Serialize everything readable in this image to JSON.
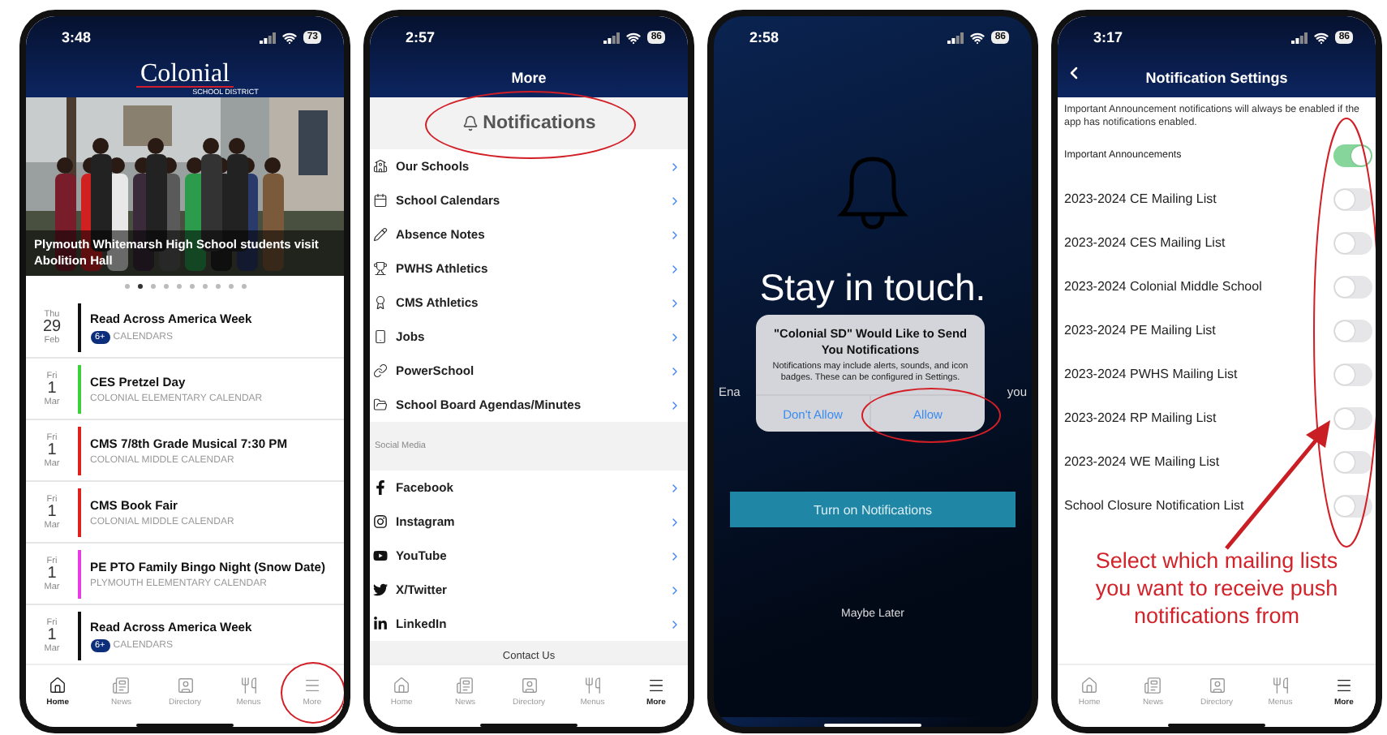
{
  "phones": [
    {
      "kind": "home",
      "status": {
        "time": "3:48",
        "battery": "73"
      },
      "logo": {
        "name": "Colonial",
        "tagline": "SCHOOL DISTRICT"
      },
      "hero": {
        "kind": "picture",
        "caption": "Plymouth Whitemarsh High School students visit Abolition Hall"
      },
      "dots": [
        {
          "selected": false
        },
        {
          "selected": true
        },
        {
          "selected": false
        },
        {
          "selected": false
        },
        {
          "selected": false
        },
        {
          "selected": false
        },
        {
          "selected": false
        },
        {
          "selected": false
        },
        {
          "selected": false
        },
        {
          "selected": false
        }
      ],
      "events": [
        {
          "weekday": "Thu",
          "day": "29",
          "month": "Feb",
          "title": "Read Across America Week",
          "badge": "6+",
          "subtitle": "CALENDARS",
          "color": "#111111"
        },
        {
          "weekday": "Fri",
          "day": "1",
          "month": "Mar",
          "title": "CES Pretzel Day",
          "subtitle": "COLONIAL ELEMENTARY CALENDAR",
          "color": "#3ad13a"
        },
        {
          "weekday": "Fri",
          "day": "1",
          "month": "Mar",
          "title": "CMS 7/8th Grade Musical 7:30 PM",
          "subtitle": "COLONIAL MIDDLE CALENDAR",
          "color": "#e0201c"
        },
        {
          "weekday": "Fri",
          "day": "1",
          "month": "Mar",
          "title": "CMS Book Fair",
          "subtitle": "COLONIAL MIDDLE CALENDAR",
          "color": "#e0201c"
        },
        {
          "weekday": "Fri",
          "day": "1",
          "month": "Mar",
          "title": "PE PTO Family Bingo Night (Snow Date)",
          "subtitle": "PLYMOUTH ELEMENTARY CALENDAR",
          "color": "#e83be8"
        },
        {
          "weekday": "Fri",
          "day": "1",
          "month": "Mar",
          "title": "Read Across America Week",
          "badge": "6+",
          "subtitle": "CALENDARS",
          "color": "#111111"
        }
      ],
      "tabs": [
        {
          "label": "Home",
          "selected": true,
          "circled": false
        },
        {
          "label": "News",
          "selected": false,
          "circled": false
        },
        {
          "label": "Directory",
          "selected": false,
          "circled": false
        },
        {
          "label": "Menus",
          "selected": false,
          "circled": false
        },
        {
          "label": "More",
          "selected": false,
          "circled": true
        }
      ]
    },
    {
      "kind": "more",
      "status": {
        "time": "2:57",
        "battery": "86"
      },
      "title": "More",
      "notifications": {
        "label": "Notifications",
        "circled": true
      },
      "items": [
        {
          "label": "Our Schools"
        },
        {
          "label": "School Calendars"
        },
        {
          "label": "Absence Notes"
        },
        {
          "label": "PWHS Athletics"
        },
        {
          "label": "CMS Athletics"
        },
        {
          "label": "Jobs"
        },
        {
          "label": "PowerSchool"
        },
        {
          "label": "School Board Agendas/Minutes"
        }
      ],
      "section": "Social Media",
      "social": [
        {
          "label": "Facebook"
        },
        {
          "label": "Instagram"
        },
        {
          "label": "YouTube"
        },
        {
          "label": "X/Twitter"
        },
        {
          "label": "LinkedIn"
        }
      ],
      "footer": "Contact Us",
      "tabs": [
        {
          "label": "Home",
          "selected": false,
          "circled": false
        },
        {
          "label": "News",
          "selected": false,
          "circled": false
        },
        {
          "label": "Directory",
          "selected": false,
          "circled": false
        },
        {
          "label": "Menus",
          "selected": false,
          "circled": false
        },
        {
          "label": "More",
          "selected": true,
          "circled": false
        }
      ]
    },
    {
      "kind": "prompt",
      "status": {
        "time": "2:58",
        "battery": "86"
      },
      "heading": "Stay in touch.",
      "covered_text": [
        "Ena",
        "you"
      ],
      "alert": {
        "title": "\"Colonial SD\" Would Like to Send You Notifications",
        "message": "Notifications may include alerts, sounds, and icon badges. These can be configured in Settings.",
        "buttons": [
          {
            "label": "Don't Allow",
            "circled": false
          },
          {
            "label": "Allow",
            "circled": true
          }
        ]
      },
      "primary_button": "Turn on Notifications",
      "secondary_link": "Maybe Later"
    },
    {
      "kind": "settings",
      "status": {
        "time": "3:17",
        "battery": "86"
      },
      "title": "Notification Settings",
      "note": "Important Announcement notifications will always be enabled if the app has notifications enabled.",
      "settings": [
        {
          "label": "Important Announcements",
          "kind": "primary",
          "on": true
        },
        {
          "label": "2023-2024 CE Mailing List",
          "kind": "list",
          "on": false
        },
        {
          "label": "2023-2024 CES Mailing List",
          "kind": "list",
          "on": false
        },
        {
          "label": "2023-2024 Colonial Middle School",
          "kind": "list",
          "on": false
        },
        {
          "label": "2023-2024 PE Mailing List",
          "kind": "list",
          "on": false
        },
        {
          "label": "2023-2024 PWHS Mailing List",
          "kind": "list",
          "on": false
        },
        {
          "label": "2023-2024 RP Mailing List",
          "kind": "list",
          "on": false
        },
        {
          "label": "2023-2024 WE Mailing List",
          "kind": "list",
          "on": false
        },
        {
          "label": "School Closure Notification List",
          "kind": "list",
          "on": false
        }
      ],
      "toggles_circled": true,
      "annotation": "Select which mailing lists you want to receive push notifications from",
      "tabs": [
        {
          "label": "Home",
          "selected": false,
          "circled": false
        },
        {
          "label": "News",
          "selected": false,
          "circled": false
        },
        {
          "label": "Directory",
          "selected": false,
          "circled": false
        },
        {
          "label": "Menus",
          "selected": false,
          "circled": false
        },
        {
          "label": "More",
          "selected": true,
          "circled": false
        }
      ]
    }
  ]
}
